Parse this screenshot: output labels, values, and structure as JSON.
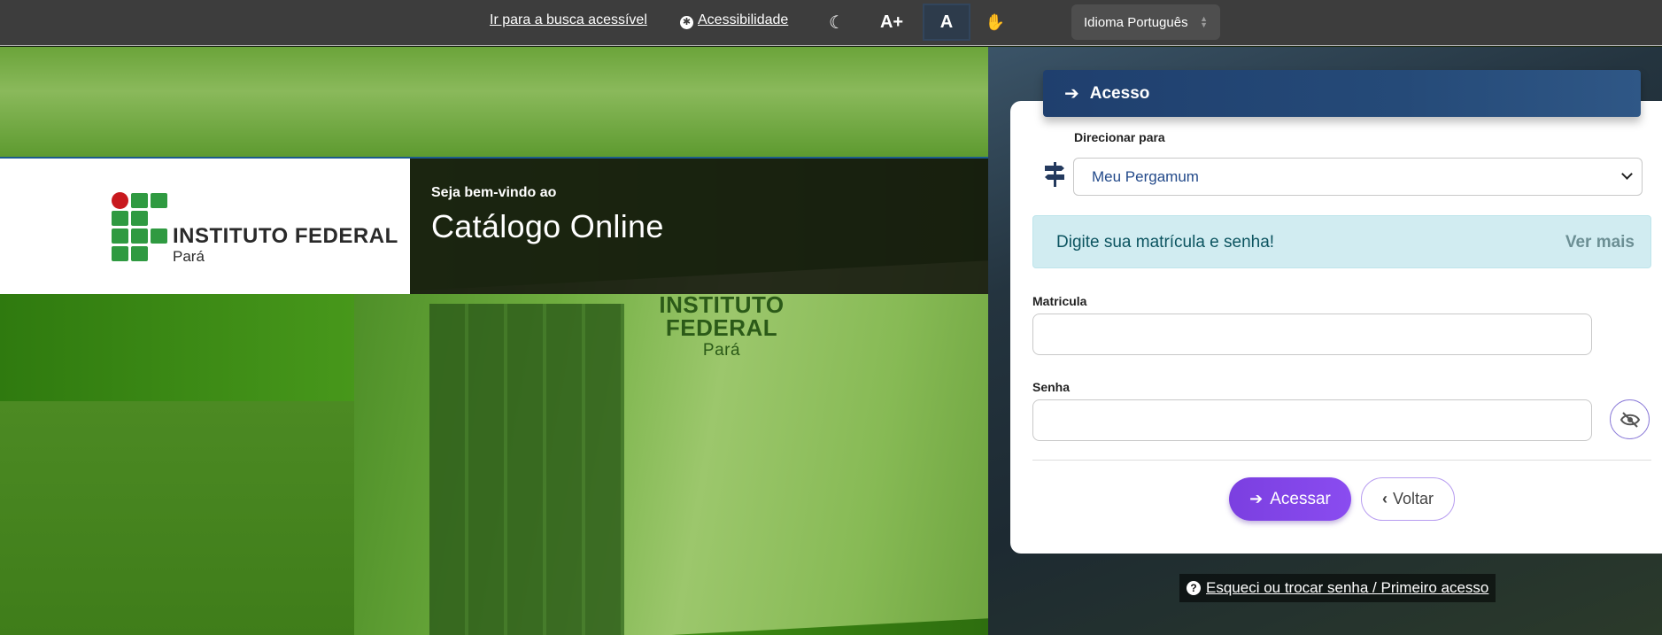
{
  "topbar": {
    "accessible_search_link": "Ir para a busca acessível",
    "accessibility_link": "Acessibilidade",
    "font_increase_label": "A+",
    "contrast_label": "A",
    "language_select": "Idioma Português"
  },
  "welcome": {
    "small": "Seja bem-vindo ao",
    "big": "Catálogo Online",
    "logo_title": "INSTITUTO FEDERAL",
    "logo_sub": "Pará"
  },
  "hero": {
    "sign_title_1": "INSTITUTO",
    "sign_title_2": "FEDERAL",
    "sign_sub": "Pará"
  },
  "login": {
    "header_title": "Acesso",
    "redirect_label": "Direcionar para",
    "redirect_value": "Meu Pergamum",
    "alert_message": "Digite sua matrícula e senha!",
    "alert_more": "Ver mais",
    "matricula_label": "Matricula",
    "matricula_value": "",
    "senha_label": "Senha",
    "senha_value": "",
    "submit_label": "Acessar",
    "back_label": "Voltar",
    "forgot_link": "Esqueci ou trocar senha / Primeiro acesso"
  },
  "colors": {
    "topbar": "#3d3d3d",
    "header_blue": "#1f3f6e",
    "accent_purple": "#7b3fe0",
    "alert_bg": "#d1ecf1",
    "alert_text": "#0c5460",
    "logo_green": "#2f9a41",
    "logo_red": "#c8191e"
  },
  "icons": {
    "accessibility": "accessibility-icon",
    "dark_mode": "moon-icon",
    "libras": "hand-icon",
    "login": "sign-in-icon",
    "redirect": "signpost-icon",
    "password_toggle": "eye-slash-icon",
    "back": "chevron-left-icon",
    "help": "question-circle-icon"
  }
}
